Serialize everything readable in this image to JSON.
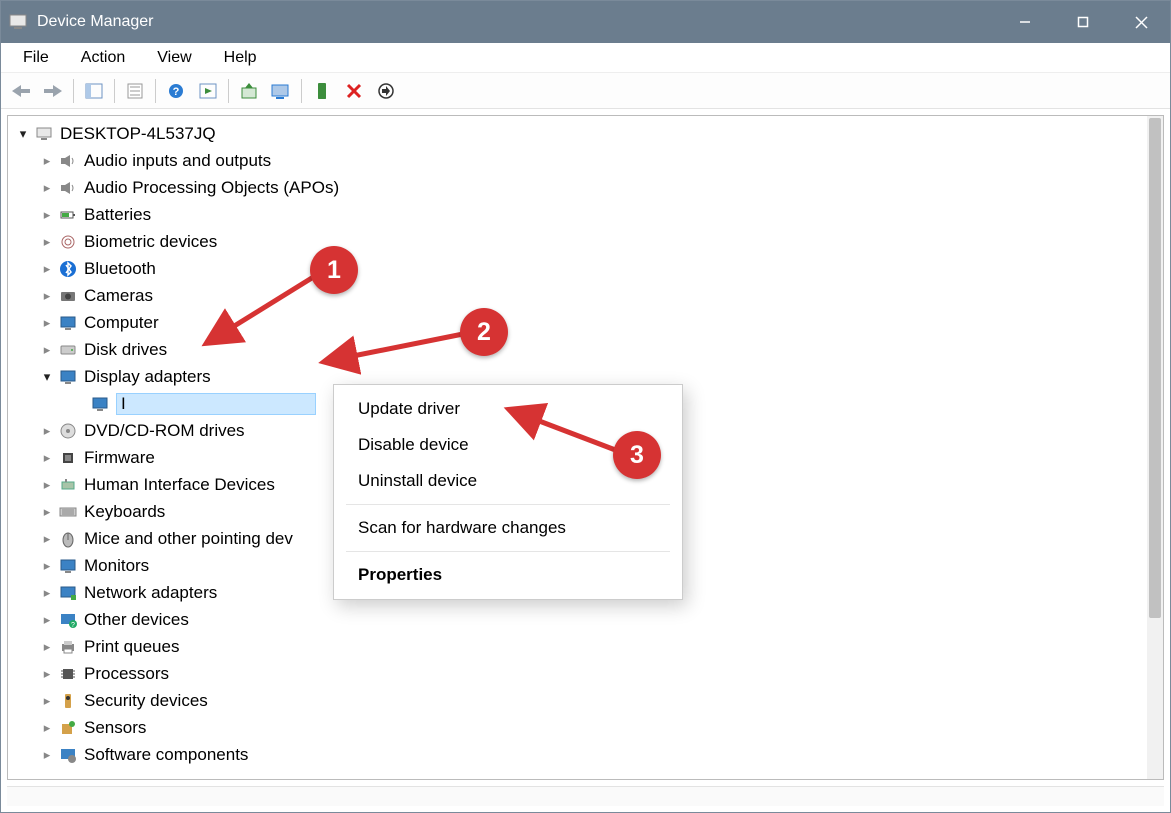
{
  "title": "Device Manager",
  "menus": {
    "file": "File",
    "action": "Action",
    "view": "View",
    "help": "Help"
  },
  "root": "DESKTOP-4L537JQ",
  "categories": [
    {
      "label": "Audio inputs and outputs",
      "icon": "speaker"
    },
    {
      "label": "Audio Processing Objects (APOs)",
      "icon": "speaker"
    },
    {
      "label": "Batteries",
      "icon": "battery"
    },
    {
      "label": "Biometric devices",
      "icon": "fingerprint"
    },
    {
      "label": "Bluetooth",
      "icon": "bluetooth"
    },
    {
      "label": "Cameras",
      "icon": "camera"
    },
    {
      "label": "Computer",
      "icon": "monitor"
    },
    {
      "label": "Disk drives",
      "icon": "disk"
    },
    {
      "label": "Display adapters",
      "icon": "monitor",
      "expanded": true
    },
    {
      "label": "DVD/CD-ROM drives",
      "icon": "disc"
    },
    {
      "label": "Firmware",
      "icon": "chip"
    },
    {
      "label": "Human Interface Devices",
      "icon": "hid"
    },
    {
      "label": "Keyboards",
      "icon": "keyboard"
    },
    {
      "label": "Mice and other pointing devices",
      "icon": "mouse",
      "truncated": "Mice and other pointing dev"
    },
    {
      "label": "Monitors",
      "icon": "monitor"
    },
    {
      "label": "Network adapters",
      "icon": "network"
    },
    {
      "label": "Other devices",
      "icon": "other"
    },
    {
      "label": "Print queues",
      "icon": "printer"
    },
    {
      "label": "Processors",
      "icon": "processor"
    },
    {
      "label": "Security devices",
      "icon": "security"
    },
    {
      "label": "Sensors",
      "icon": "sensor"
    },
    {
      "label": "Software components",
      "icon": "software"
    }
  ],
  "selected_child": "I",
  "context_menu": {
    "items": [
      {
        "label": "Update driver",
        "kind": "item"
      },
      {
        "label": "Disable device",
        "kind": "item"
      },
      {
        "label": "Uninstall device",
        "kind": "item"
      },
      {
        "kind": "sep"
      },
      {
        "label": "Scan for hardware changes",
        "kind": "item"
      },
      {
        "kind": "sep"
      },
      {
        "label": "Properties",
        "kind": "item",
        "bold": true
      }
    ]
  },
  "annotations": {
    "b1": "1",
    "b2": "2",
    "b3": "3"
  }
}
